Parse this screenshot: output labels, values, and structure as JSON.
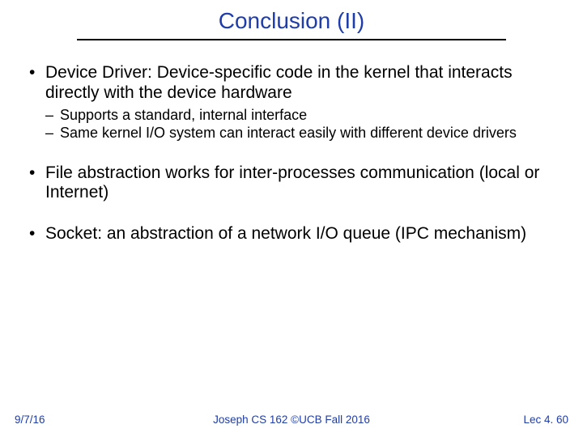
{
  "title": "Conclusion (II)",
  "bullets": [
    {
      "text": "Device Driver: Device-specific code in the kernel that interacts directly with the device hardware",
      "sub": [
        "Supports a standard, internal interface",
        "Same kernel I/O system can interact easily with different device drivers"
      ]
    },
    {
      "text": "File abstraction works for inter-processes communication (local or Internet)",
      "sub": []
    },
    {
      "text": "Socket: an abstraction of a network I/O queue (IPC mechanism)",
      "sub": []
    }
  ],
  "footer": {
    "date": "9/7/16",
    "center": "Joseph CS 162 ©UCB Fall 2016",
    "right": "Lec 4. 60"
  }
}
